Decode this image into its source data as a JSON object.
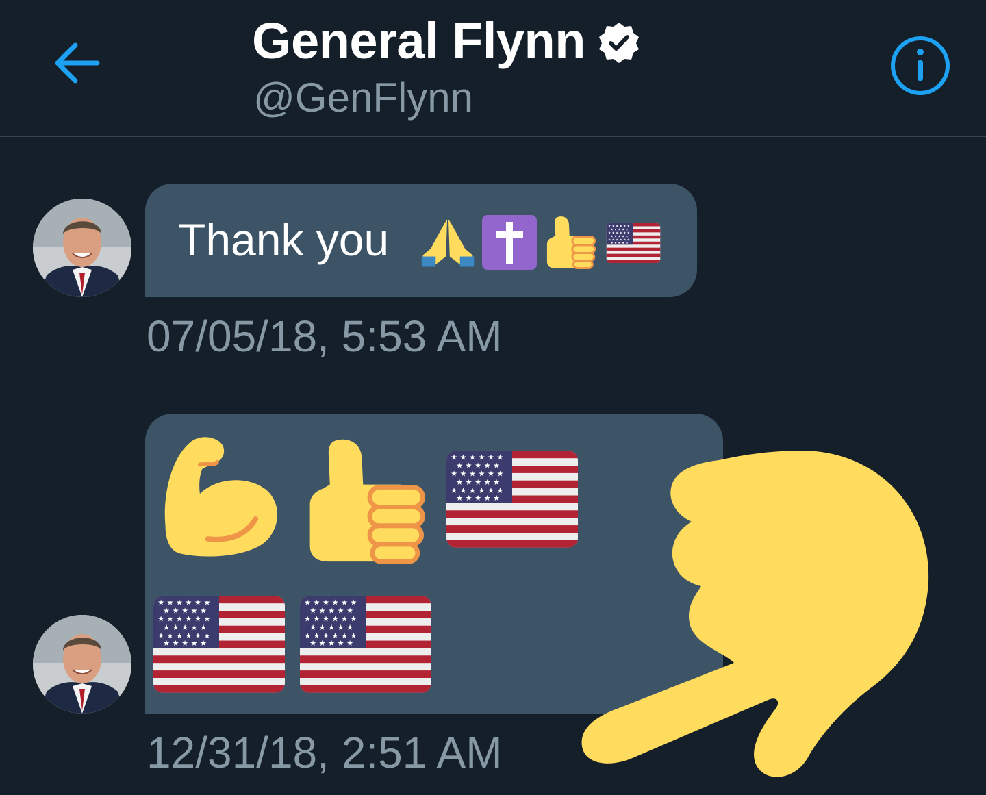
{
  "header": {
    "title": "General Flynn",
    "handle": "@GenFlynn",
    "verified": true,
    "back_icon": "arrow-left-icon",
    "info_icon": "info-icon"
  },
  "messages": [
    {
      "text": "Thank you",
      "emojis": [
        "folded-hands",
        "latin-cross",
        "thumbs-up",
        "us-flag"
      ],
      "timestamp": "07/05/18, 5:53 AM"
    },
    {
      "text": "",
      "emojis": [
        "flexed-biceps",
        "thumbs-up",
        "us-flag",
        "us-flag",
        "us-flag"
      ],
      "timestamp": "12/31/18, 2:51 AM"
    }
  ],
  "overlay": {
    "icon": "backhand-index-pointing-down"
  },
  "colors": {
    "background": "#151f2a",
    "bubble": "#3d5466",
    "accent": "#1da1f2",
    "muted_text": "#8899a6",
    "emoji_yellow": "#ffdb5e"
  }
}
